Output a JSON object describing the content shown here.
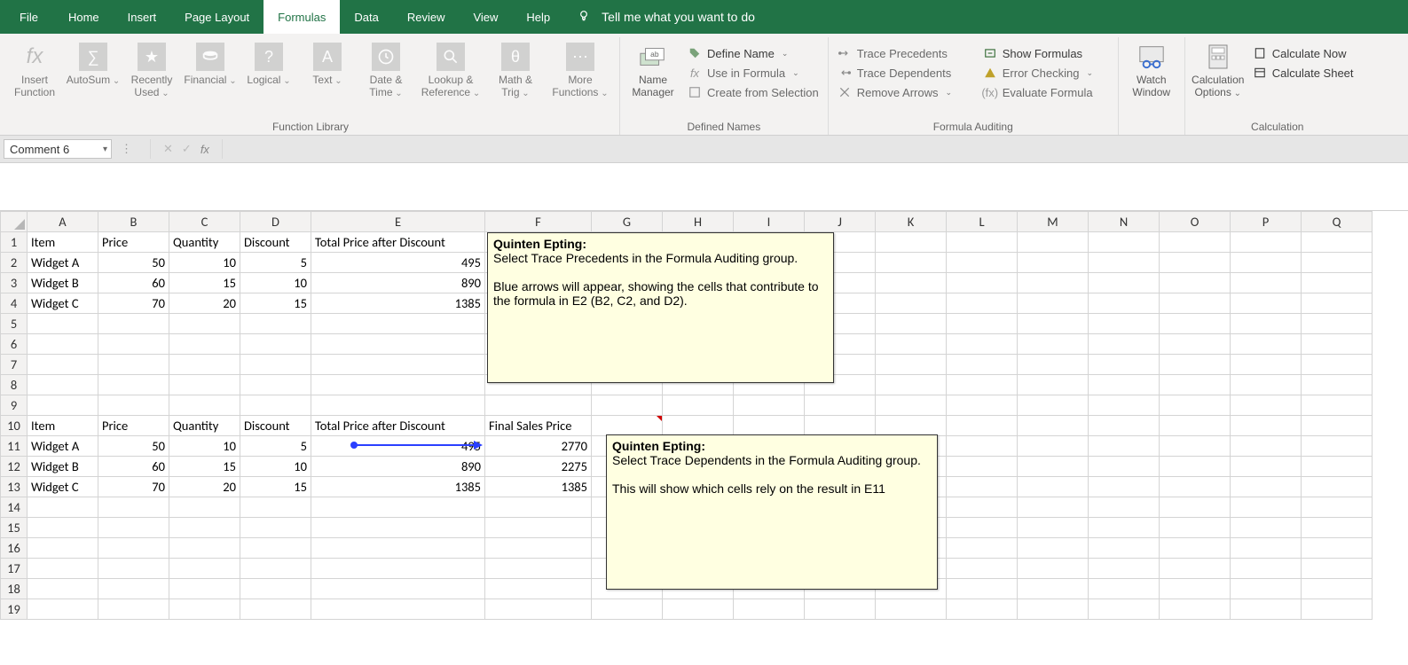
{
  "menubar": [
    "File",
    "Home",
    "Insert",
    "Page Layout",
    "Formulas",
    "Data",
    "Review",
    "View",
    "Help"
  ],
  "menubar_active": "Formulas",
  "tellme": "Tell me what you want to do",
  "ribbon": {
    "func_library_label": "Function Library",
    "insert_function": "Insert\nFunction",
    "autosum": "AutoSum",
    "recently": "Recently\nUsed",
    "financial": "Financial",
    "logical": "Logical",
    "text": "Text",
    "datetime": "Date &\nTime",
    "lookup": "Lookup &\nReference",
    "mathtrig": "Math &\nTrig",
    "more": "More\nFunctions",
    "defined_names_label": "Defined Names",
    "name_manager": "Name\nManager",
    "define_name": "Define Name",
    "use_in_formula": "Use in Formula",
    "create_from_selection": "Create from Selection",
    "auditing_label": "Formula Auditing",
    "trace_precedents": "Trace Precedents",
    "trace_dependents": "Trace Dependents",
    "remove_arrows": "Remove Arrows",
    "show_formulas": "Show Formulas",
    "error_checking": "Error Checking",
    "evaluate_formula": "Evaluate Formula",
    "watch_window": "Watch\nWindow",
    "calc_label": "Calculation",
    "calc_options": "Calculation\nOptions",
    "calc_now": "Calculate Now",
    "calc_sheet": "Calculate Sheet"
  },
  "name_box": "Comment 6",
  "sheet": {
    "cols": [
      "A",
      "B",
      "C",
      "D",
      "E",
      "F",
      "G",
      "H",
      "I",
      "J",
      "K",
      "L",
      "M",
      "N",
      "O",
      "P",
      "Q"
    ],
    "row_count": 19,
    "comment_cells": [
      "F1",
      "G10"
    ],
    "table1_header_row": 1,
    "table1_headers": [
      "Item",
      "Price",
      "Quantity",
      "Discount",
      "Total Price after Discount"
    ],
    "table1_data_start_row": 2,
    "table1_rows": [
      {
        "item": "Widget A",
        "price": 50,
        "qty": 10,
        "discount": 5,
        "total": 495
      },
      {
        "item": "Widget B",
        "price": 60,
        "qty": 15,
        "discount": 10,
        "total": 890
      },
      {
        "item": "Widget C",
        "price": 70,
        "qty": 20,
        "discount": 15,
        "total": 1385
      }
    ],
    "table2_header_row": 10,
    "table2_headers": [
      "Item",
      "Price",
      "Quantity",
      "Discount",
      "Total Price after Discount",
      "Final Sales Price"
    ],
    "table2_data_start_row": 11,
    "table2_rows": [
      {
        "item": "Widget A",
        "price": 50,
        "qty": 10,
        "discount": 5,
        "total": 495,
        "final": 2770
      },
      {
        "item": "Widget B",
        "price": 60,
        "qty": 15,
        "discount": 10,
        "total": 890,
        "final": 2275
      },
      {
        "item": "Widget C",
        "price": 70,
        "qty": 20,
        "discount": 15,
        "total": 1385,
        "final": 1385
      }
    ]
  },
  "comments": {
    "c1": {
      "author": "Quinten Epting:",
      "l1": "Select Trace Precedents in the Formula Auditing group.",
      "l2": "Blue arrows will appear, showing the cells that contribute to the formula in E2 (B2, C2, and D2)."
    },
    "c2": {
      "author": "Quinten Epting:",
      "l1": "Select Trace Dependents in the Formula Auditing group.",
      "l2": "This will show which cells rely on the result in E11"
    }
  }
}
